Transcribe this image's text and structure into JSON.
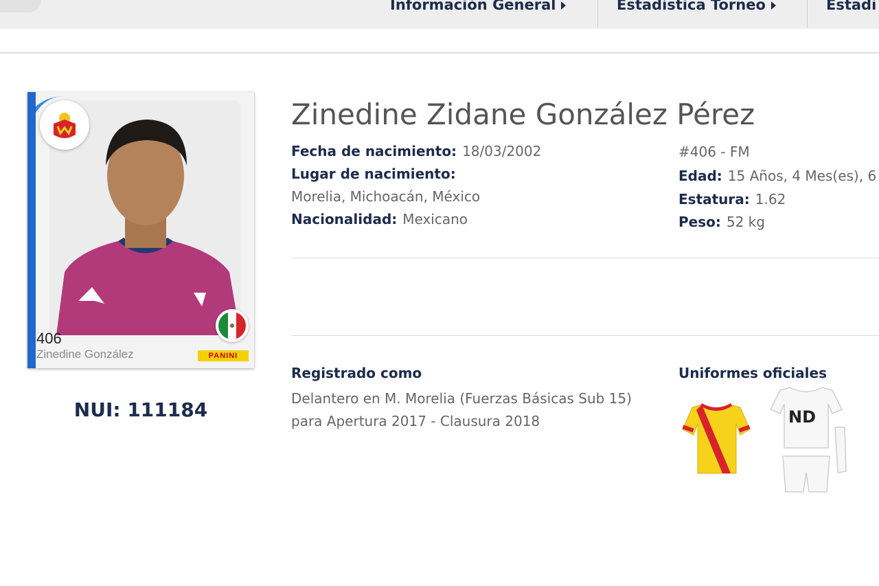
{
  "nav": {
    "items": [
      {
        "label": "Información General"
      },
      {
        "label": "Estadística Torneo"
      },
      {
        "label": "Estadí"
      }
    ]
  },
  "sticker": {
    "number": "406",
    "name": "Zinedine González",
    "brand": "PANINI",
    "club_badge_icon": "monarcas-morelia-crest-icon",
    "flag_icon": "mexico-flag-icon"
  },
  "nui": "NUI: 111184",
  "player": {
    "full_name": "Zinedine Zidane González Pérez",
    "birth_date_label": "Fecha de nacimiento:",
    "birth_date_value": "18/03/2002",
    "birth_place_label": "Lugar de nacimiento:",
    "birth_place_value": "Morelia, Michoacán, México",
    "nationality_label": "Nacionalidad:",
    "nationality_value": "Mexicano",
    "number_position": "#406 - FM",
    "age_label": "Edad:",
    "age_value": "15 Años, 4 Mes(es), 6",
    "height_label": "Estatura:",
    "height_value": "1.62",
    "weight_label": "Peso:",
    "weight_value": "52 kg"
  },
  "registration": {
    "title": "Registrado como",
    "line1": "Delantero en M. Morelia (Fuerzas Básicas Sub 15)",
    "line2": "para Apertura 2017 - Clausura 2018"
  },
  "uniforms": {
    "title": "Uniformes oficiales",
    "away_label": "ND"
  },
  "colors": {
    "nav_text": "#1d2b4c",
    "sticker_blue": "#2268c8",
    "jersey_yellow": "#f6d21a",
    "jersey_red": "#d8232a"
  }
}
